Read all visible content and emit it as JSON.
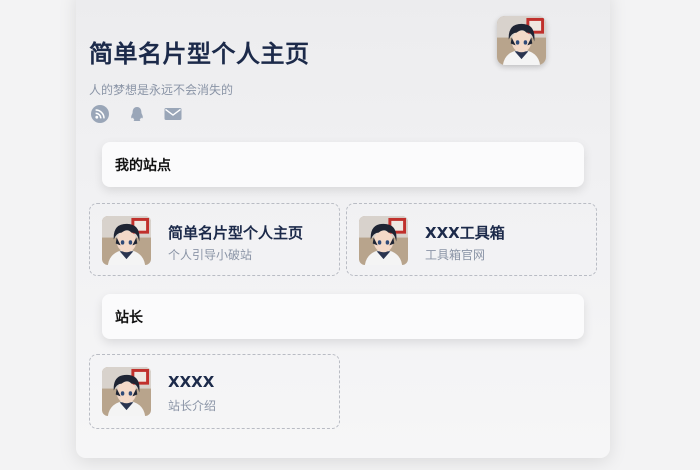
{
  "header": {
    "title": "简单名片型个人主页",
    "subtitle": "人的梦想是永远不会消失的"
  },
  "social": {
    "icons": [
      "rss-icon",
      "qq-icon",
      "email-icon"
    ],
    "color": "#9aa6b8"
  },
  "sections": [
    {
      "title": "我的站点",
      "cards": [
        {
          "title": "简单名片型个人主页",
          "desc": "个人引导小破站"
        },
        {
          "title": "XXX工具箱",
          "desc": "工具箱官网"
        }
      ]
    },
    {
      "title": "站长",
      "cards": [
        {
          "title": "XXXX",
          "desc": "站长介绍"
        }
      ]
    }
  ],
  "colors": {
    "title": "#1c2a4a",
    "muted": "#8a94a6",
    "card_border": "#b9bcc4"
  }
}
